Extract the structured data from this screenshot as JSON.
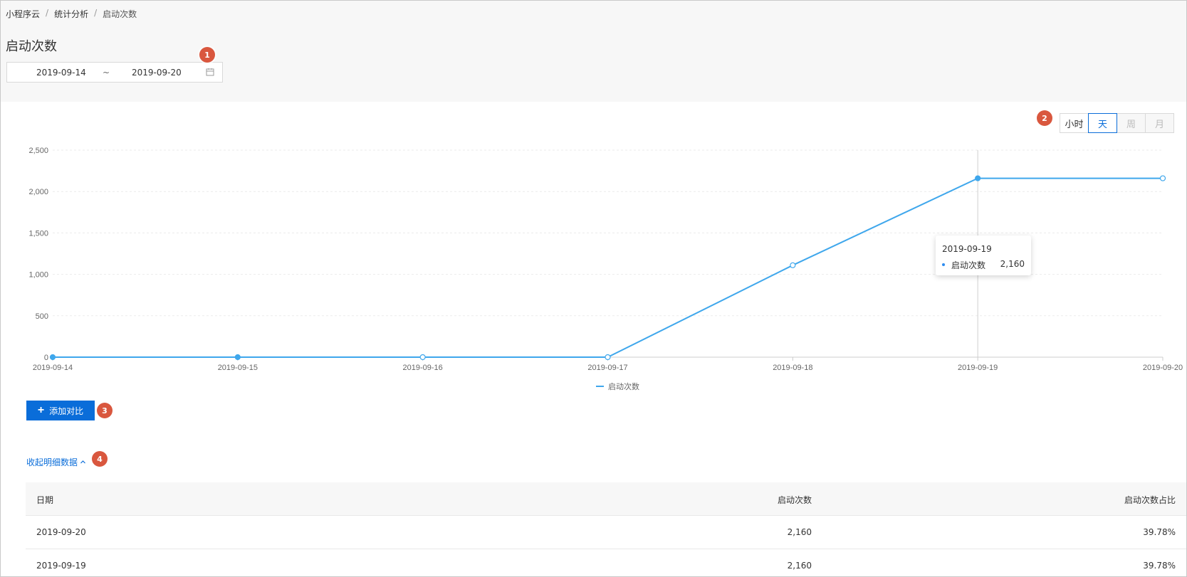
{
  "breadcrumb": [
    "小程序云",
    "统计分析",
    "启动次数"
  ],
  "page_title": "启动次数",
  "date_range": {
    "start": "2019-09-14",
    "separator": "~",
    "end": "2019-09-20",
    "icon": "calendar-icon"
  },
  "badges": [
    "1",
    "2",
    "3",
    "4"
  ],
  "period_buttons": [
    {
      "label": "小时",
      "state": "normal"
    },
    {
      "label": "天",
      "state": "active"
    },
    {
      "label": "周",
      "state": "disabled"
    },
    {
      "label": "月",
      "state": "disabled"
    }
  ],
  "chart_data": {
    "type": "line",
    "categories": [
      "2019-09-14",
      "2019-09-15",
      "2019-09-16",
      "2019-09-17",
      "2019-09-18",
      "2019-09-19",
      "2019-09-20"
    ],
    "series": [
      {
        "name": "启动次数",
        "values": [
          0,
          0,
          0,
          0,
          1110,
          2160,
          2160
        ]
      }
    ],
    "ylim": [
      0,
      2500
    ],
    "y_ticks": [
      "0",
      "500",
      "1,000",
      "1,500",
      "2,000",
      "2,500"
    ],
    "y_tick_values": [
      0,
      500,
      1000,
      1500,
      2000,
      2500
    ],
    "grid": true,
    "legend": "bottom-center",
    "color": "#3fa7ec",
    "tooltip": {
      "date": "2019-09-19",
      "series": "启动次数",
      "value": "2,160"
    }
  },
  "actions": {
    "add_compare_label": "添加对比",
    "collapse_label": "收起明细数据"
  },
  "table": {
    "headers": [
      "日期",
      "启动次数",
      "启动次数占比"
    ],
    "rows": [
      [
        "2019-09-20",
        "2,160",
        "39.78%"
      ],
      [
        "2019-09-19",
        "2,160",
        "39.78%"
      ]
    ]
  },
  "colors": {
    "accent": "#0a6dd9",
    "badge": "#d9573e",
    "line": "#3fa7ec"
  }
}
